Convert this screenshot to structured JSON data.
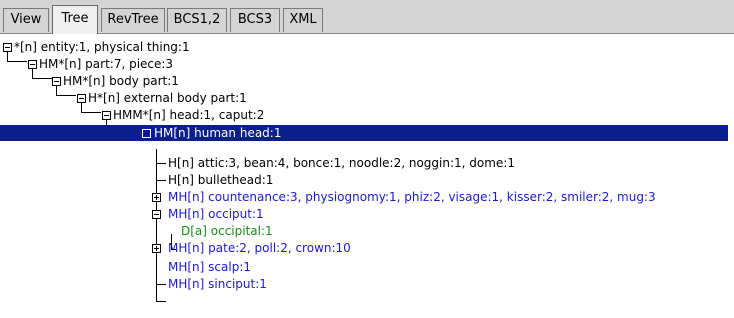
{
  "tabs": [
    {
      "id": "view",
      "label": "View"
    },
    {
      "id": "tree",
      "label": "Tree"
    },
    {
      "id": "revtree",
      "label": "RevTree"
    },
    {
      "id": "bcs12",
      "label": "BCS1,2"
    },
    {
      "id": "bcs3",
      "label": "BCS3"
    },
    {
      "id": "xml",
      "label": "XML"
    }
  ],
  "active_tab": "Tree",
  "tree": {
    "nodes": [
      {
        "text": "*[n] entity:1, physical thing:1",
        "expander": "minus"
      },
      {
        "text": "HM*[n] part:7, piece:3",
        "expander": "minus"
      },
      {
        "text": "HM*[n] body part:1",
        "expander": "minus"
      },
      {
        "text": "H*[n] external body part:1",
        "expander": "minus"
      },
      {
        "text": "HMM*[n] head:1, caput:2",
        "expander": "minus"
      },
      {
        "text": "HM[n] human head:1",
        "expander": "minus",
        "selected": true
      },
      {
        "text": "H[n] attic:3, bean:4, bonce:1, noodle:2, noggin:1, dome:1",
        "expander": "none"
      },
      {
        "text": "H[n] bullethead:1",
        "expander": "none"
      },
      {
        "text": "MH[n] countenance:3, physiognomy:1, phiz:2, visage:1, kisser:2, smiler:2, mug:3",
        "expander": "plus",
        "color": "blue"
      },
      {
        "text": "MH[n] occiput:1",
        "expander": "minus",
        "color": "blue"
      },
      {
        "text": "D[a] occipital:1",
        "expander": "none",
        "color": "green"
      },
      {
        "text": "MH[n] pate:2, poll:2, crown:10",
        "expander": "plus",
        "color": "blue"
      },
      {
        "text": "MH[n] scalp:1",
        "expander": "none",
        "color": "blue"
      },
      {
        "text": "MH[n] sinciput:1",
        "expander": "none",
        "color": "blue"
      }
    ]
  },
  "colors": {
    "selection": "#0a1e8c",
    "blue_text": "#1a1ad4",
    "green_text": "#1a8a1a"
  }
}
